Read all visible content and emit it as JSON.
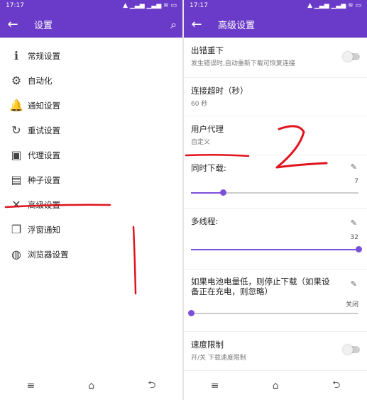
{
  "left": {
    "status_time": "17:17",
    "status_right": "▲ ▁▃▅ ▁▃▅ ≋ ▭",
    "title": "设置",
    "back_glyph": "←",
    "search_glyph": "⌕",
    "menu": [
      {
        "label": "常规设置",
        "icon": "info-icon",
        "glyph": "ℹ"
      },
      {
        "label": "自动化",
        "icon": "automation-icon",
        "glyph": "⚙"
      },
      {
        "label": "通知设置",
        "icon": "bell-icon",
        "glyph": "🔔"
      },
      {
        "label": "重试设置",
        "icon": "retry-icon",
        "glyph": "↻"
      },
      {
        "label": "代理设置",
        "icon": "proxy-icon",
        "glyph": "▣"
      },
      {
        "label": "种子设置",
        "icon": "torrent-file-icon",
        "glyph": "▤"
      },
      {
        "label": "高级设置",
        "icon": "wrench-icon",
        "glyph": "✕"
      },
      {
        "label": "浮窗通知",
        "icon": "floating-window-icon",
        "glyph": "❐"
      },
      {
        "label": "浏览器设置",
        "icon": "globe-icon",
        "glyph": "◍"
      }
    ],
    "nav": {
      "menu": "≡",
      "home": "⌂",
      "back": "⮌"
    }
  },
  "right": {
    "status_time": "17:17",
    "status_right": "▲ ▁▃▅ ▁▃▅ ≋ ▭",
    "title": "高级设置",
    "back_glyph": "←",
    "retry_on_error": {
      "title": "出错重下",
      "subtitle": "发生错误时,自动重新下载可恢复连接",
      "enabled": false
    },
    "timeout": {
      "title": "连接超时（秒）",
      "value": "60 秒"
    },
    "user_agent": {
      "title": "用户代理",
      "value": "自定义"
    },
    "concurrent": {
      "title": "同时下载:",
      "value": "7",
      "fraction": 0.19
    },
    "threads": {
      "title": "多线程:",
      "value": "32",
      "fraction": 1.0
    },
    "battery": {
      "title": "如果电池电量低，则停止下载（如果设备正在充电，则忽略）",
      "value": "关闭",
      "fraction": 0.0
    },
    "speed_limit": {
      "title": "速度限制",
      "subtitle": "开/关 下载速度限制",
      "enabled": false
    },
    "pencil_glyph": "✎",
    "nav": {
      "menu": "≡",
      "home": "⌂",
      "back": "⮌"
    }
  },
  "colors": {
    "accent": "#6a3ac8",
    "slider": "#7b4fd6",
    "annotation": "#e0141e"
  },
  "annotations": {
    "handwritten_number": "2"
  }
}
